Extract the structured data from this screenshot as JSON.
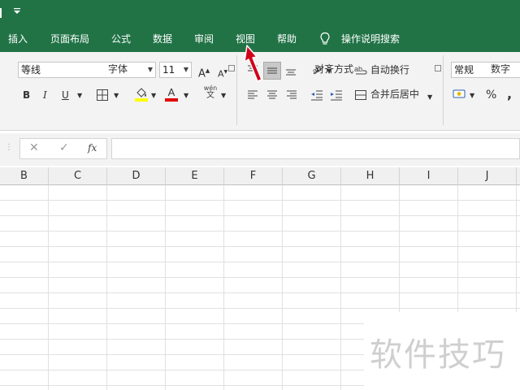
{
  "title_bar": {
    "qat_icon": "customize-qat-arrow-icon"
  },
  "ribbon_tabs": [
    {
      "id": "insert",
      "label": "插入"
    },
    {
      "id": "page-layout",
      "label": "页面布局"
    },
    {
      "id": "formulas",
      "label": "公式"
    },
    {
      "id": "data",
      "label": "数据"
    },
    {
      "id": "review",
      "label": "审阅"
    },
    {
      "id": "view",
      "label": "视图"
    },
    {
      "id": "help",
      "label": "帮助"
    }
  ],
  "tell_me": {
    "icon": "lightbulb-icon",
    "label": "操作说明搜索"
  },
  "font_group": {
    "font_name": "等线",
    "font_size": "11",
    "grow_label": "A",
    "shrink_label": "A",
    "bold": "B",
    "italic": "I",
    "underline": "U",
    "phonetic_top": "wén",
    "phonetic_bottom": "文",
    "label": "字体",
    "fill_color": "#ffff00",
    "font_color": "#e00000"
  },
  "alignment_group": {
    "wrap_text": "自动换行",
    "merge_center": "合并后居中",
    "label": "对齐方式"
  },
  "number_group": {
    "format": "常规",
    "percent": "%",
    "comma": ",",
    "label": "数字"
  },
  "formula_bar": {
    "cancel": "✕",
    "enter": "✓",
    "fx": "fx",
    "value": ""
  },
  "columns": [
    "B",
    "C",
    "D",
    "E",
    "F",
    "G",
    "H",
    "I",
    "J"
  ],
  "watermark": "软件技巧",
  "colors": {
    "ribbon_green": "#217346",
    "arrow_red": "#d0021b"
  }
}
